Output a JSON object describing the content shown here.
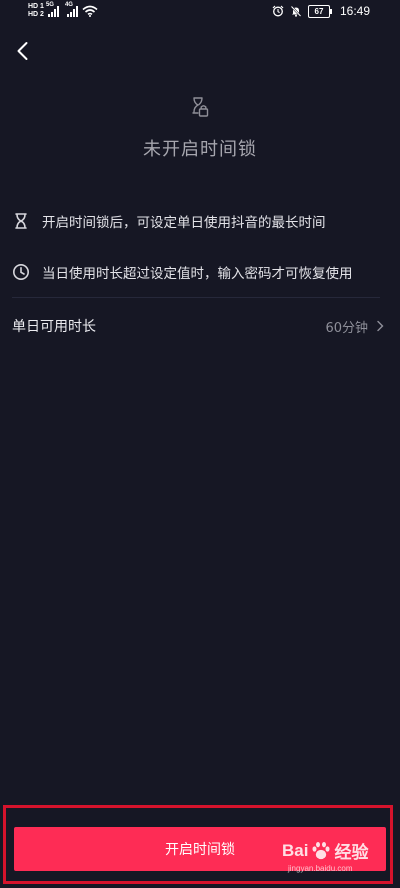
{
  "status_bar": {
    "sim1": "HD 1",
    "sim2": "HD 2",
    "net1": "5G",
    "net2": "4G",
    "battery": "67",
    "time": "16:49"
  },
  "hero": {
    "icon": "hourglass-lock-icon",
    "title": "未开启时间锁"
  },
  "info": [
    {
      "icon": "hourglass-icon",
      "text": "开启时间锁后，可设定单日使用抖音的最长时间"
    },
    {
      "icon": "clock-icon",
      "text": "当日使用时长超过设定值时，输入密码才可恢复使用"
    }
  ],
  "setting": {
    "label": "单日可用时长",
    "value": "60分钟"
  },
  "primary_button": {
    "label": "开启时间锁"
  },
  "watermark": {
    "brand_prefix": "Bai",
    "brand_suffix": "经验",
    "url": "jingyan.baidu.com"
  },
  "colors": {
    "background": "#161724",
    "primary": "#fe2c55",
    "highlight": "#d5132c"
  }
}
